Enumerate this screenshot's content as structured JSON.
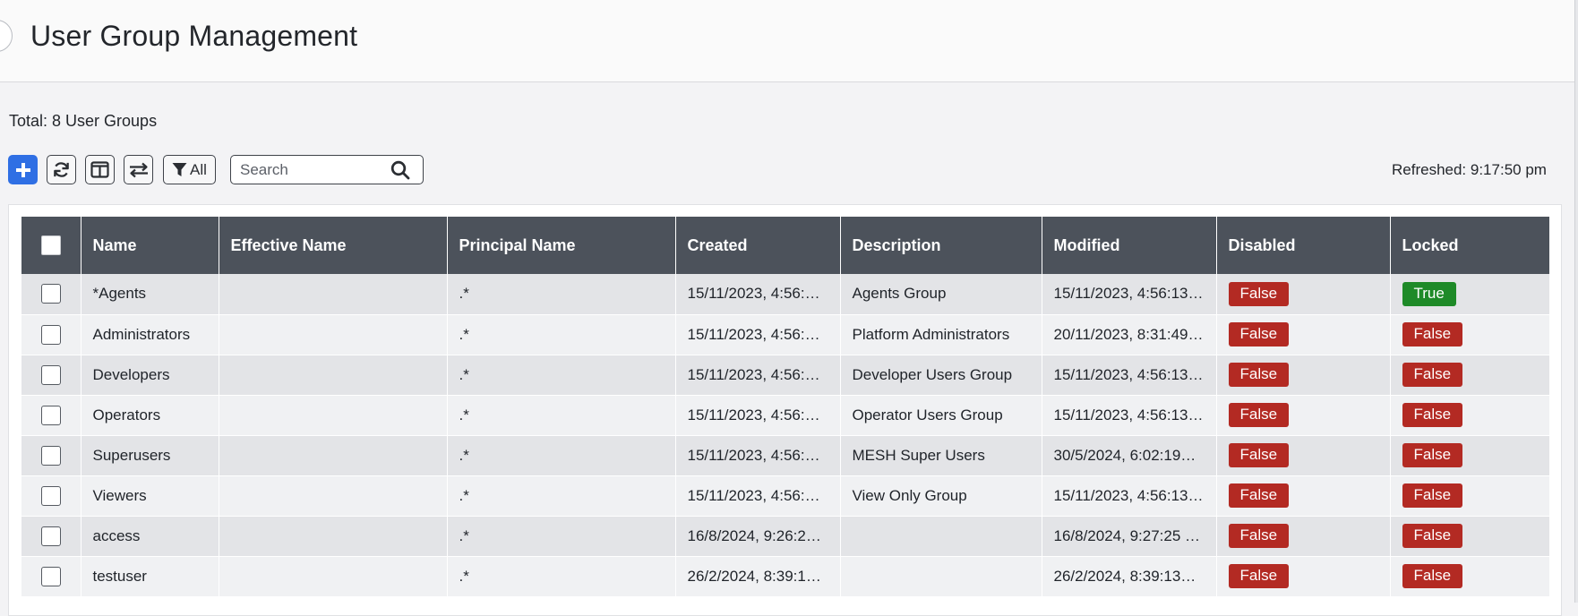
{
  "header": {
    "title": "User Group Management"
  },
  "summary": {
    "total_text": "Total: 8 User Groups"
  },
  "toolbar": {
    "add_icon": "plus-icon",
    "refresh_icon": "refresh-icon",
    "columns_icon": "columns-icon",
    "swap_icon": "swap-arrows-icon",
    "filter_icon": "filter-icon",
    "filter_label": "All",
    "search_placeholder": "Search",
    "search_icon": "search-icon",
    "refreshed_text": "Refreshed: 9:17:50 pm"
  },
  "colors": {
    "accent": "#2f6fe4",
    "header_bg": "#4c525b",
    "badge_false": "#b32a23",
    "badge_true": "#1e8a28"
  },
  "table": {
    "columns": [
      "Name",
      "Effective Name",
      "Principal Name",
      "Created",
      "Description",
      "Modified",
      "Disabled",
      "Locked"
    ],
    "rows": [
      {
        "name": "*Agents",
        "effective_name": "",
        "principal_name": ".*",
        "created": "15/11/2023, 4:56:1…",
        "description": "Agents Group",
        "modified": "15/11/2023, 4:56:13…",
        "disabled": "False",
        "locked": "True"
      },
      {
        "name": "Administrators",
        "effective_name": "",
        "principal_name": ".*",
        "created": "15/11/2023, 4:56:1…",
        "description": "Platform Administrators",
        "modified": "20/11/2023, 8:31:49…",
        "disabled": "False",
        "locked": "False"
      },
      {
        "name": "Developers",
        "effective_name": "",
        "principal_name": ".*",
        "created": "15/11/2023, 4:56:1…",
        "description": "Developer Users Group",
        "modified": "15/11/2023, 4:56:13…",
        "disabled": "False",
        "locked": "False"
      },
      {
        "name": "Operators",
        "effective_name": "",
        "principal_name": ".*",
        "created": "15/11/2023, 4:56:1…",
        "description": "Operator Users Group",
        "modified": "15/11/2023, 4:56:13…",
        "disabled": "False",
        "locked": "False"
      },
      {
        "name": "Superusers",
        "effective_name": "",
        "principal_name": ".*",
        "created": "15/11/2023, 4:56:1…",
        "description": "MESH Super Users",
        "modified": "30/5/2024, 6:02:19…",
        "disabled": "False",
        "locked": "False"
      },
      {
        "name": "Viewers",
        "effective_name": "",
        "principal_name": ".*",
        "created": "15/11/2023, 4:56:1…",
        "description": "View Only Group",
        "modified": "15/11/2023, 4:56:13…",
        "disabled": "False",
        "locked": "False"
      },
      {
        "name": "access",
        "effective_name": "",
        "principal_name": ".*",
        "created": "16/8/2024, 9:26:2…",
        "description": "",
        "modified": "16/8/2024, 9:27:25 …",
        "disabled": "False",
        "locked": "False"
      },
      {
        "name": "testuser",
        "effective_name": "",
        "principal_name": ".*",
        "created": "26/2/2024, 8:39:1…",
        "description": "",
        "modified": "26/2/2024, 8:39:13…",
        "disabled": "False",
        "locked": "False"
      }
    ]
  }
}
